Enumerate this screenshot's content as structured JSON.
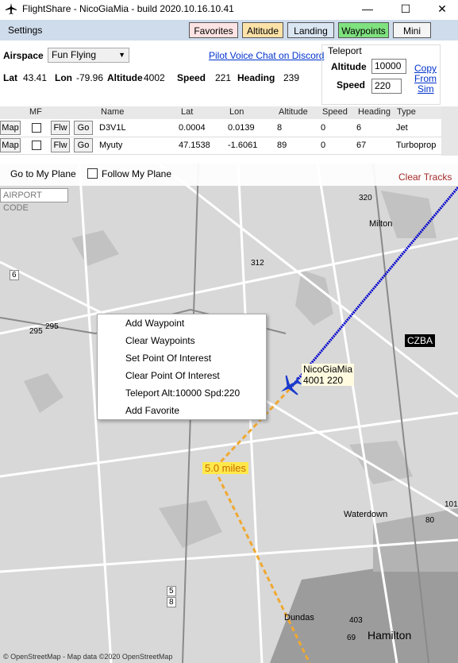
{
  "window": {
    "title": "FlightShare - NicoGiaMia - build 2020.10.16.10.41",
    "minimize": "—",
    "maximize": "☐",
    "close": "✕"
  },
  "menu": {
    "settings": "Settings"
  },
  "toolbar": {
    "favorites": "Favorites",
    "altitude": "Altitude",
    "landing": "Landing",
    "waypoints": "Waypoints",
    "mini": "Mini",
    "colors": {
      "favorites": "#fde3e3",
      "altitude": "#fde2a8",
      "landing": "#dbe6f3",
      "waypoints": "#7fe27f",
      "mini": "#f5f5f5"
    }
  },
  "info": {
    "airspace_label": "Airspace",
    "airspace_value": "Fun Flying",
    "voice_link": "Pilot Voice Chat on Discord",
    "lat_label": "Lat",
    "lat_value": "43.41",
    "lon_label": "Lon",
    "lon_value": "-79.96",
    "alt_label": "Altitude",
    "alt_value": "4002",
    "speed_label": "Speed",
    "speed_value": "221",
    "heading_label": "Heading",
    "heading_value": "239"
  },
  "teleport": {
    "title": "Teleport",
    "altitude_label": "Altitude",
    "altitude_value": "10000",
    "speed_label": "Speed",
    "speed_value": "220",
    "copy_link": [
      "Copy",
      "From",
      "Sim"
    ]
  },
  "grid": {
    "headers": [
      "MF",
      "Name",
      "Lat",
      "Lon",
      "Altitude",
      "Speed",
      "Heading",
      "Type"
    ],
    "map_btn": "Map",
    "flw_btn": "Flw",
    "go_btn": "Go",
    "rows": [
      {
        "name": "D3V1L",
        "lat": "0.0004",
        "lon": "0.0139",
        "altitude": "8",
        "speed": "0",
        "heading": "6",
        "type": "Jet"
      },
      {
        "name": "Myuty",
        "lat": "47.1538",
        "lon": "-1.6061",
        "altitude": "89",
        "speed": "0",
        "heading": "67",
        "type": "Turboprop"
      }
    ]
  },
  "map": {
    "goto_btn": "Go to My Plane",
    "follow_label": "Follow My Plane",
    "clear_tracks": "Clear Tracks",
    "airport_placeholder": "AIRPORT CODE",
    "context_menu": [
      "Add Waypoint",
      "Clear Waypoints",
      "Set Point Of Interest",
      "Clear Point Of Interest",
      "Teleport Alt:10000 Spd:220",
      "Add Favorite"
    ],
    "plane_label_1": "NicoGiaMia",
    "plane_label_2": "4001 220",
    "distance_label": "5.0 miles",
    "airport_tag": "CZBA",
    "places": [
      "Milton",
      "Waterdown",
      "Dundas",
      "Hamilton"
    ],
    "road_numbers": [
      "320",
      "312",
      "6",
      "295",
      "295",
      "5",
      "8",
      "403",
      "69",
      "101",
      "80"
    ],
    "attribution": "© OpenStreetMap - Map data ©2020 OpenStreetMap",
    "colors": {
      "track": "#0000cc",
      "route": "#f0a830",
      "plane": "#1a3acc"
    }
  }
}
